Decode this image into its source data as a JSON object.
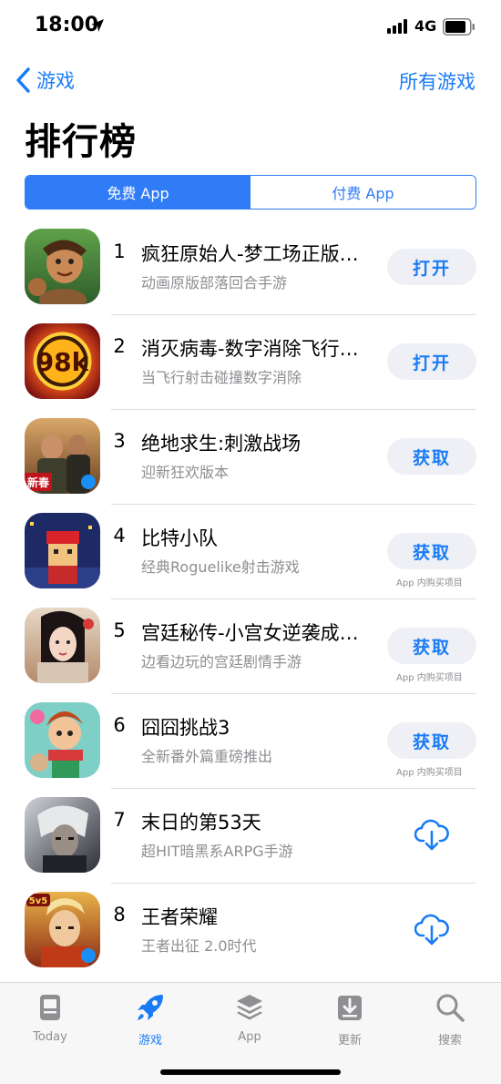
{
  "status_bar": {
    "time": "18:00",
    "network": "4G"
  },
  "nav": {
    "back_label": "游戏",
    "right_label": "所有游戏"
  },
  "page": {
    "title": "排行榜"
  },
  "segments": {
    "free": "免费 App",
    "paid": "付费 App",
    "active": "free"
  },
  "apps": [
    {
      "rank": "1",
      "name": "疯狂原始人-梦工场正版授权",
      "subtitle": "动画原版部落回合手游",
      "action": "打开",
      "action_type": "button",
      "iap": ""
    },
    {
      "rank": "2",
      "name": "消灭病毒-数字消除飞行射击",
      "subtitle": "当飞行射击碰撞数字消除",
      "action": "打开",
      "action_type": "button",
      "iap": ""
    },
    {
      "rank": "3",
      "name": "绝地求生:刺激战场",
      "subtitle": "迎新狂欢版本",
      "action": "获取",
      "action_type": "button",
      "iap": ""
    },
    {
      "rank": "4",
      "name": "比特小队",
      "subtitle": "经典Roguelike射击游戏",
      "action": "获取",
      "action_type": "button",
      "iap": "App 内购买项目"
    },
    {
      "rank": "5",
      "name": "宫廷秘传-小宫女逆袭成王后",
      "subtitle": "边看边玩的宫廷剧情手游",
      "action": "获取",
      "action_type": "button",
      "iap": "App 内购买项目"
    },
    {
      "rank": "6",
      "name": "囧囧挑战3",
      "subtitle": "全新番外篇重磅推出",
      "action": "获取",
      "action_type": "button",
      "iap": "App 内购买项目"
    },
    {
      "rank": "7",
      "name": "末日的第53天",
      "subtitle": "超HIT暗黑系ARPG手游",
      "action": "",
      "action_type": "download",
      "iap": ""
    },
    {
      "rank": "8",
      "name": "王者荣耀",
      "subtitle": "王者出征 2.0时代",
      "action": "",
      "action_type": "download",
      "iap": ""
    }
  ],
  "tabs": [
    {
      "label": "Today",
      "icon": "today-icon",
      "active": false
    },
    {
      "label": "游戏",
      "icon": "rocket-icon",
      "active": true
    },
    {
      "label": "App",
      "icon": "layers-icon",
      "active": false
    },
    {
      "label": "更新",
      "icon": "download-tray-icon",
      "active": false
    },
    {
      "label": "搜索",
      "icon": "search-icon",
      "active": false
    }
  ],
  "colors": {
    "accent": "#1a7cf5",
    "secondary_text": "#8e8e93",
    "button_bg": "#eef0f6"
  }
}
